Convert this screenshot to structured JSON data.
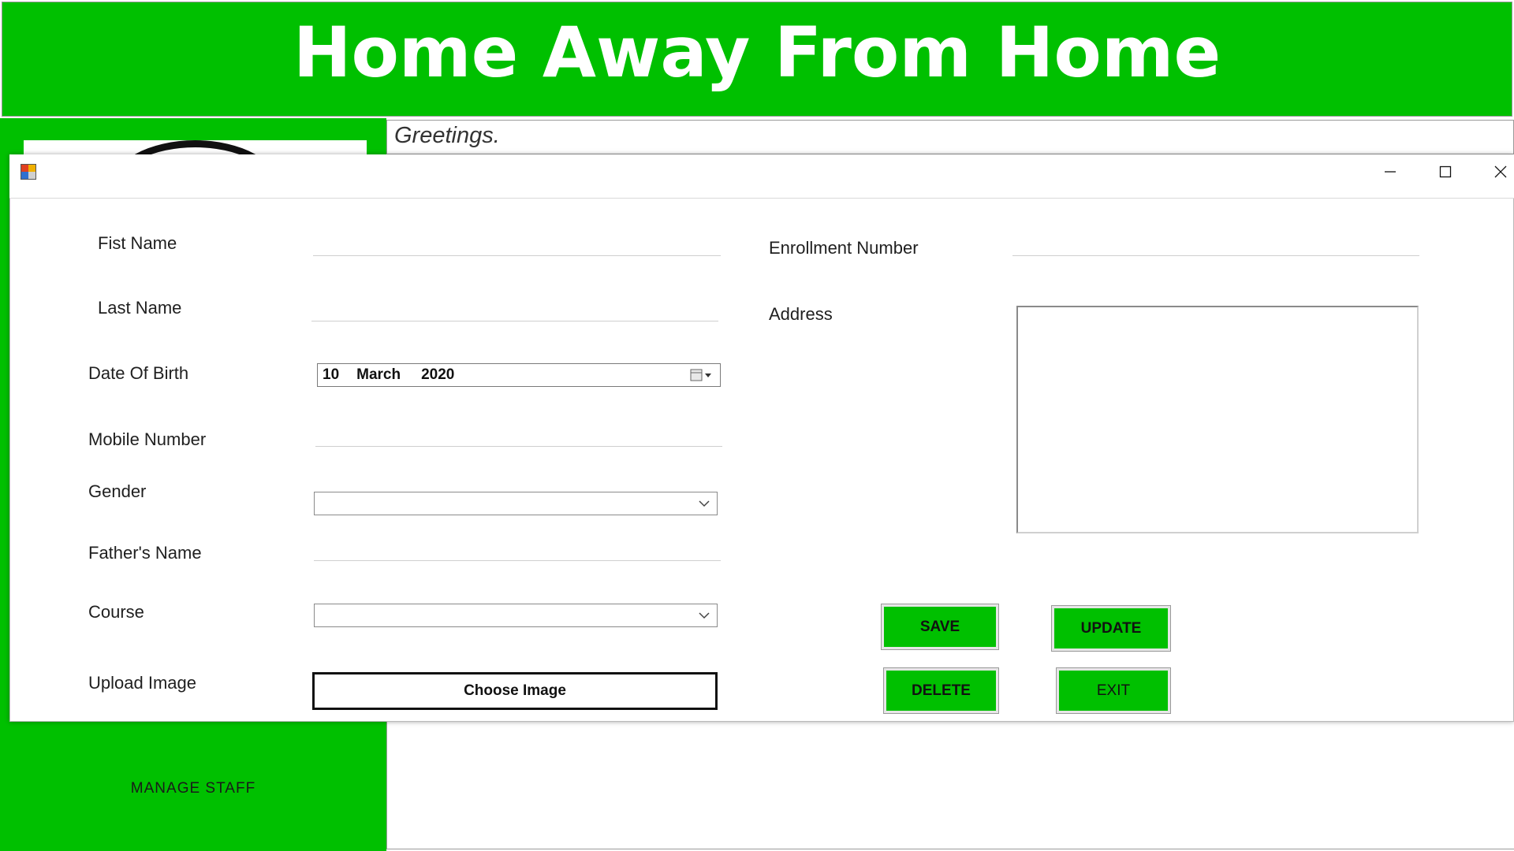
{
  "app": {
    "title": "Home Away From Home",
    "greeting": "Greetings.",
    "sidebar_item": "MANAGE STAFF"
  },
  "dialog": {
    "labels": {
      "first_name": "Fist Name",
      "last_name": "Last Name",
      "dob": "Date Of Birth",
      "mobile": "Mobile Number",
      "gender": "Gender",
      "father": "Father's Name",
      "course": "Course",
      "upload": "Upload Image",
      "enrollment": "Enrollment Number",
      "address": "Address"
    },
    "fields": {
      "first_name": "",
      "last_name": "",
      "mobile": "",
      "father": "",
      "enrollment": "",
      "address": "",
      "gender": "",
      "course": ""
    },
    "dob": {
      "day": "10",
      "month": "March",
      "year": "2020"
    },
    "buttons": {
      "choose_image": "Choose Image",
      "save": "SAVE",
      "update": "UPDATE",
      "delete": "DELETE",
      "exit": "EXIT"
    }
  },
  "colors": {
    "brand_green": "#00c000",
    "white": "#ffffff"
  },
  "icons": {
    "window": [
      "minimize-icon",
      "maximize-icon",
      "close-icon"
    ],
    "date": "calendar-icon",
    "combo": "chevron-down-icon"
  }
}
